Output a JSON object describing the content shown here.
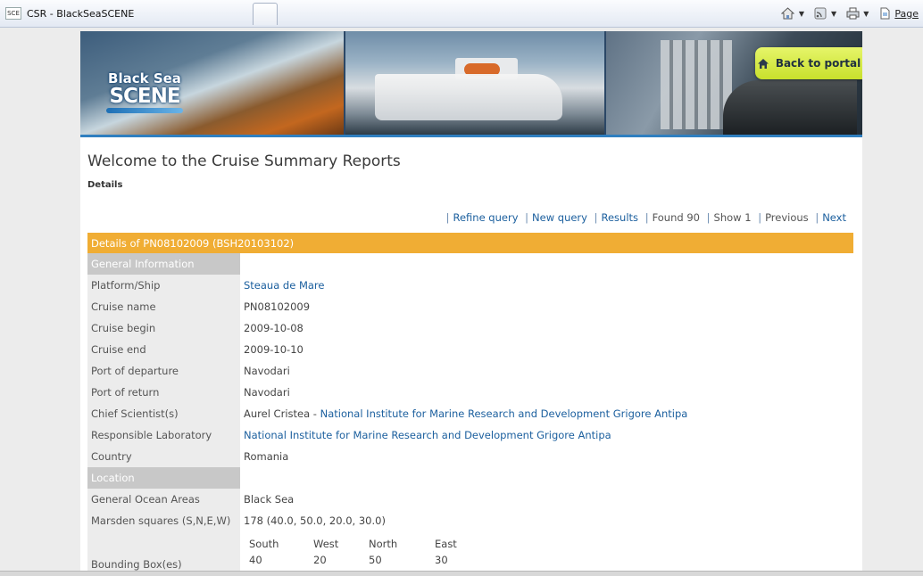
{
  "browser": {
    "tab_title": "CSR - BlackSeaSCENE",
    "favicon_text": "SCE",
    "commands": {
      "home": "home-icon",
      "feeds": "rss-icon",
      "print": "print-icon",
      "page_label": "Page"
    }
  },
  "banner": {
    "logo_line1": "Black Sea",
    "logo_line2": "SCENE",
    "back_to_portal": "Back to portal"
  },
  "page": {
    "title": "Welcome to the Cruise Summary Reports",
    "subtitle": "Details"
  },
  "nav": {
    "refine_query": "Refine query",
    "new_query": "New query",
    "results": "Results",
    "found": "Found 90",
    "show": "Show 1",
    "previous": "Previous",
    "next": "Next"
  },
  "details": {
    "header": "Details of PN08102009 (BSH20103102)",
    "general_section": "General Information",
    "platform_label": "Platform/Ship",
    "platform_value": "Steaua de Mare",
    "cruise_name_label": "Cruise name",
    "cruise_name_value": "PN08102009",
    "cruise_begin_label": "Cruise begin",
    "cruise_begin_value": "2009-10-08",
    "cruise_end_label": "Cruise end",
    "cruise_end_value": "2009-10-10",
    "port_departure_label": "Port of departure",
    "port_departure_value": "Navodari",
    "port_return_label": "Port of return",
    "port_return_value": "Navodari",
    "chief_label": "Chief Scientist(s)",
    "chief_name": "Aurel Cristea",
    "chief_sep": " - ",
    "chief_institute": "National Institute for Marine Research and Development Grigore Antipa",
    "lab_label": "Responsible Laboratory",
    "lab_value": "National Institute for Marine Research and Development Grigore Antipa",
    "country_label": "Country",
    "country_value": "Romania",
    "location_section": "Location",
    "ocean_label": "General Ocean Areas",
    "ocean_value": "Black Sea",
    "marsden_label": "Marsden squares (S,N,E,W)",
    "marsden_value": "178 (40.0, 50.0, 20.0, 30.0)",
    "bbox_label": "Bounding Box(es)",
    "bbox_headers": [
      "South",
      "West",
      "North",
      "East"
    ],
    "bbox_values": [
      "40",
      "20",
      "50",
      "30"
    ]
  },
  "colors": {
    "header_orange": "#f0ad34",
    "link_blue": "#1b5f9e",
    "portal_button": "#d4e843"
  }
}
